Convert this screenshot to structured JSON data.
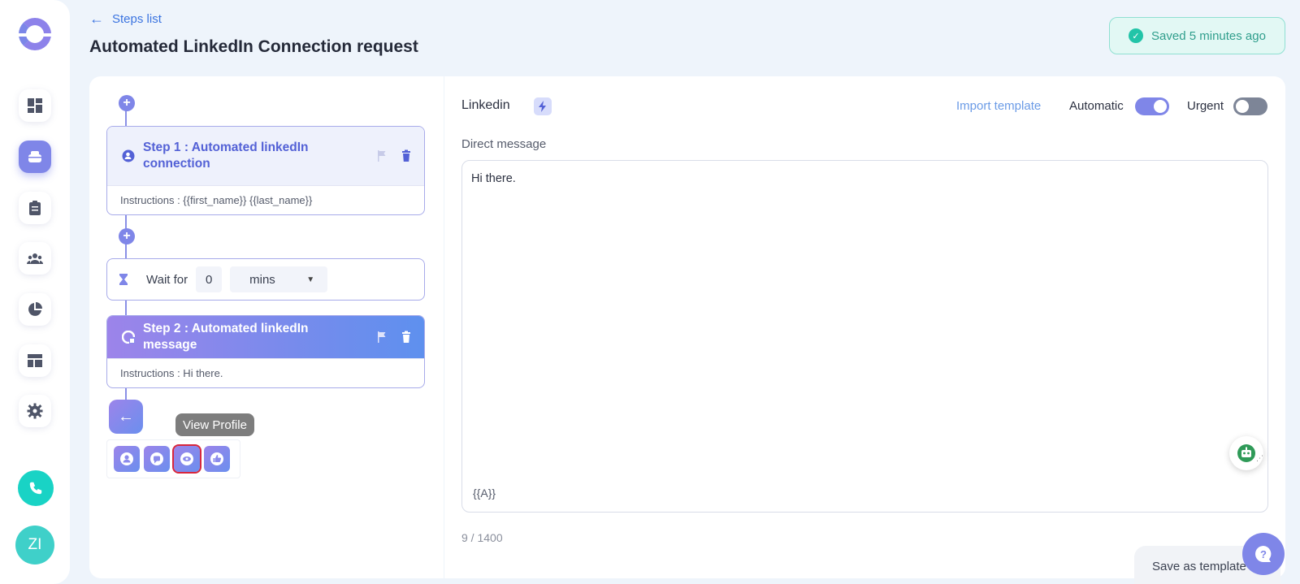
{
  "header": {
    "back_label": "Steps list",
    "title": "Automated LinkedIn Connection request",
    "saved_status": "Saved 5 minutes ago"
  },
  "sidebar": {
    "items": [
      {
        "icon": "dashboard-icon"
      },
      {
        "icon": "campaign-icon",
        "active": true
      },
      {
        "icon": "clipboard-icon"
      },
      {
        "icon": "people-icon"
      },
      {
        "icon": "pie-chart-icon"
      },
      {
        "icon": "template-icon"
      },
      {
        "icon": "gear-icon"
      }
    ],
    "avatar_initials": "ZI"
  },
  "steps": {
    "step1": {
      "title": "Step 1 : Automated linkedIn connection",
      "instructions": "Instructions : {{first_name}} {{last_name}}"
    },
    "wait": {
      "label": "Wait for",
      "value": "0",
      "unit": "mins"
    },
    "step2": {
      "title": "Step 2 : Automated linkedIn message",
      "instructions": "Instructions : Hi there."
    },
    "tooltip": "View Profile"
  },
  "editor": {
    "channel": "Linkedin",
    "import_template": "Import template",
    "automatic_label": "Automatic",
    "automatic_on": true,
    "urgent_label": "Urgent",
    "urgent_on": false,
    "section_label": "Direct message",
    "message": "Hi there.",
    "variable_hint": "{{A}}",
    "char_count": "9 / 1400",
    "save_template": "Save as template"
  },
  "colors": {
    "accent": "#7f86e8",
    "teal": "#19d3c5",
    "link": "#3b74e0"
  }
}
